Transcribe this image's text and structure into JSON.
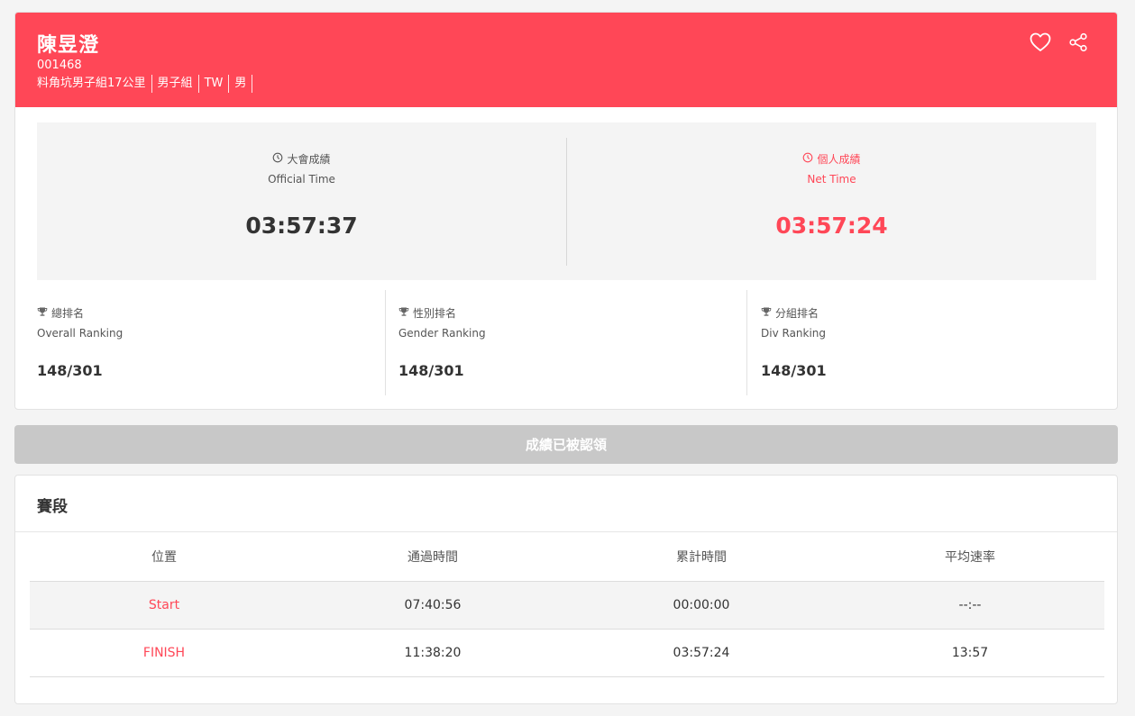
{
  "runner": {
    "name": "陳昱澄",
    "bib": "001468",
    "tags": [
      "料角坑男子組17公里",
      "男子組",
      "TW",
      "男"
    ]
  },
  "icons": {
    "favorite": "heart-icon",
    "share": "share-icon",
    "clock": "clock-icon",
    "trophy": "trophy-icon"
  },
  "colors": {
    "accent": "#ff4757",
    "disabled": "#c8c8c8"
  },
  "official_time": {
    "label_zh": "大會成績",
    "label_en": "Official Time",
    "value": "03:57:37"
  },
  "net_time": {
    "label_zh": "個人成績",
    "label_en": "Net Time",
    "value": "03:57:24"
  },
  "rankings": [
    {
      "label_zh": "總排名",
      "label_en": "Overall Ranking",
      "value": "148/301"
    },
    {
      "label_zh": "性別排名",
      "label_en": "Gender Ranking",
      "value": "148/301"
    },
    {
      "label_zh": "分組排名",
      "label_en": "Div Ranking",
      "value": "148/301"
    }
  ],
  "claim_button": "成績已被認領",
  "splits": {
    "title": "賽段",
    "headers": [
      "位置",
      "通過時間",
      "累計時間",
      "平均速率"
    ],
    "rows": [
      {
        "location": "Start",
        "pass_time": "07:40:56",
        "cumulative": "00:00:00",
        "pace": "--:--"
      },
      {
        "location": "FINISH",
        "pass_time": "11:38:20",
        "cumulative": "03:57:24",
        "pace": "13:57"
      }
    ]
  }
}
